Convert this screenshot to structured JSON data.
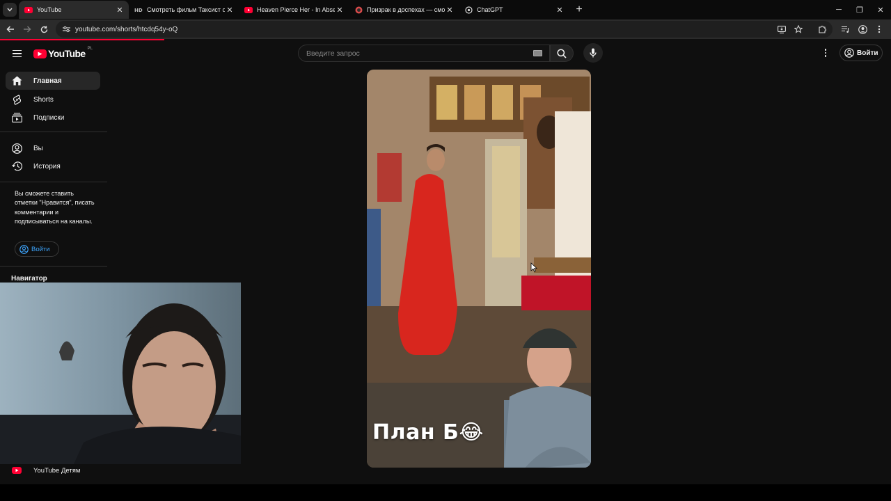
{
  "browser": {
    "tabs": [
      {
        "title": "YouTube",
        "active": true,
        "icon": "youtube-icon"
      },
      {
        "title": "Смотреть фильм Таксист онлайн",
        "active": false,
        "icon": "hd-icon"
      },
      {
        "title": "Heaven Pierce Her - In Absentia",
        "active": false,
        "icon": "youtube-icon"
      },
      {
        "title": "Призрак в доспехах — смотреть",
        "active": false,
        "icon": "red-circle-icon"
      },
      {
        "title": "ChatGPT",
        "active": false,
        "icon": "chatgpt-icon"
      }
    ],
    "new_tab": "+",
    "url": "youtube.com/shorts/htcdq54y-oQ",
    "accent": "#ff0033"
  },
  "masthead": {
    "logo_text": "YouTube",
    "region": "PL",
    "search_placeholder": "Введите запрос",
    "signin_label": "Войти"
  },
  "sidebar": {
    "items": [
      {
        "label": "Главная",
        "icon": "home-icon",
        "active": true
      },
      {
        "label": "Shorts",
        "icon": "shorts-icon",
        "active": false
      },
      {
        "label": "Подписки",
        "icon": "subscriptions-icon",
        "active": false
      },
      {
        "label": "Вы",
        "icon": "account-icon",
        "active": false
      },
      {
        "label": "История",
        "icon": "history-icon",
        "active": false
      }
    ],
    "promo_text": "Вы сможете ставить отметки \"Нравится\", писать комментарии и подписываться на каналы.",
    "signin_label": "Войти",
    "navigator_heading": "Навигатор",
    "kids_label": "YouTube Детям"
  },
  "short": {
    "caption": "План Б😂"
  }
}
